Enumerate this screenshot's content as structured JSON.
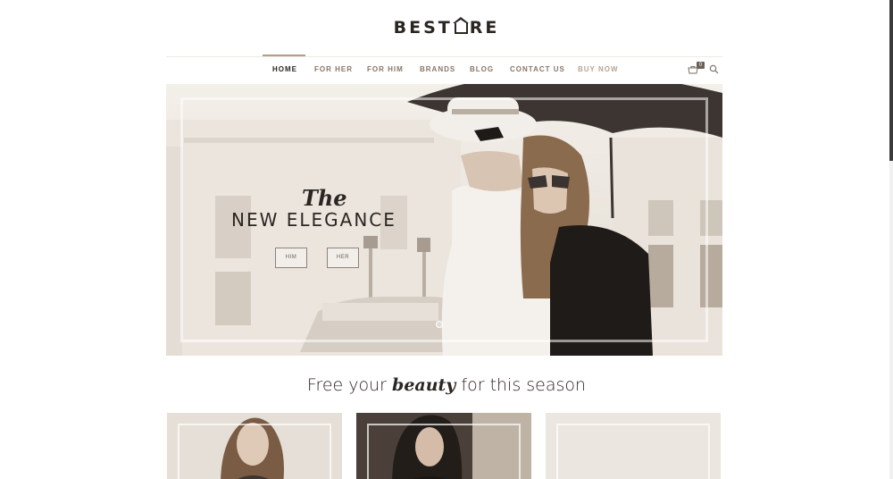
{
  "brand": {
    "logo_left": "BEST",
    "logo_right": "RE"
  },
  "nav": {
    "items": [
      {
        "label": "HOME"
      },
      {
        "label": "FOR HER"
      },
      {
        "label": "FOR HIM"
      },
      {
        "label": "BRANDS"
      },
      {
        "label": "BLOG"
      },
      {
        "label": "CONTACT US"
      },
      {
        "label": "BUY NOW"
      }
    ],
    "cart_count": "0"
  },
  "hero": {
    "kicker": "The",
    "title": "NEW ELEGANCE",
    "buttons": [
      {
        "label": "HIM"
      },
      {
        "label": "HER"
      }
    ]
  },
  "tagline": {
    "before": "Free your ",
    "emphasis": "beauty",
    "after": " for this season"
  },
  "colors": {
    "accent": "#b59d85",
    "text_dark": "#2b2622",
    "nav_text": "#8a7566",
    "sepia_bg": "#e8e2db"
  }
}
